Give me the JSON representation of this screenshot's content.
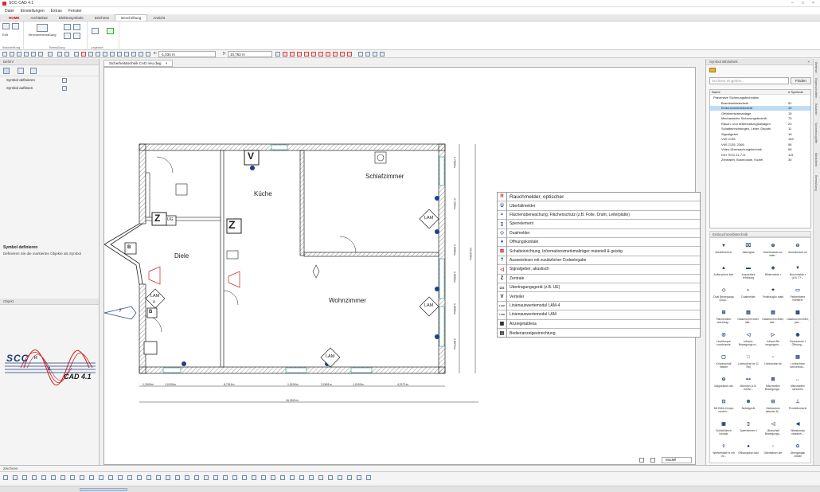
{
  "window": {
    "title": "SCC-CAD 4.1"
  },
  "menu": [
    "Datei",
    "Einstellungen",
    "Extras",
    "Fenster"
  ],
  "ribbon_tabs": [
    {
      "label": "HOME",
      "brand": true
    },
    {
      "label": "Architektur"
    },
    {
      "label": "Elektrosymbole"
    },
    {
      "label": "Zeichnen"
    },
    {
      "label": "Beschriftung",
      "active": true
    },
    {
      "label": "Ansicht"
    }
  ],
  "ribbon": {
    "groups": [
      "Beschriftung",
      "Bemaßung",
      "Legende"
    ],
    "edit_label": "Edit",
    "dimension_label": "Streckenbemaßung"
  },
  "toolbar": {
    "x_label": "x:",
    "x_value": "-1,034 m",
    "y_label": "y:",
    "y_value": "10,762 m"
  },
  "document_tab": "Sicherheitstechnik CAD neu.dwg",
  "left_panel": {
    "title": "Befehl",
    "items": [
      "Symbol definieren",
      "Symbol auflösen"
    ],
    "info_title": "Symbol definieren",
    "info_text": "Definieren Sie die markierten Objekte als Symbol",
    "object_title": "Objekt",
    "logo_text": "SCC",
    "logo_letters": [
      "H",
      "S"
    ],
    "logo_sub": "CAD 4.1"
  },
  "plan": {
    "rooms": [
      "Schlafzimmer",
      "Küche",
      "Diele",
      "Wohnzimmer"
    ],
    "dims_bottom": [
      "1,2000m",
      "1,0100m",
      "8,7011m",
      "1,0100m",
      "2,2601m",
      "1,0100m",
      "4,2171m"
    ],
    "dim_total": "16,3021m",
    "dims_right": [
      "1,7500m",
      "2,7453m",
      "1,5000m",
      "1,5000m",
      "1,0000m",
      "2,8875m"
    ],
    "dim_right_total": "13,1232m",
    "labels": [
      "V",
      "Z",
      "ÜG",
      "B",
      "LAM",
      "LAM",
      "LAM",
      "LAM",
      "4",
      "?"
    ]
  },
  "legend": [
    {
      "sym": "R",
      "text": "Rauchmelder, optischer",
      "big": true
    },
    {
      "sym": "Ü",
      "text": "Überfallmelder"
    },
    {
      "sym": "≈",
      "text": "Flächenüberwachung, Flächenschutz (z.B. Folie, Draht, Leiterplatte)"
    },
    {
      "sym": "▯",
      "text": "Sperrelement"
    },
    {
      "sym": "◇",
      "text": "Dualmelder"
    },
    {
      "sym": "●",
      "text": "Öffnungskontakt"
    },
    {
      "sym": "⊠",
      "text": "Schalteinrichtung, Informationsmerkmalträger materiell & geistig"
    },
    {
      "sym": "?",
      "text": "Ausweisleser mit zusätzlicher Codeeingabe"
    },
    {
      "sym": "◁",
      "text": "Signalgeber, akustisch"
    },
    {
      "sym": "Z",
      "text": "Zentrale"
    },
    {
      "sym": "ÜG",
      "text": "Übertragungsgerät (z.B. ÜE)"
    },
    {
      "sym": "V",
      "text": "Verteiler"
    },
    {
      "sym": "LAM",
      "text": "Linienauswertemodul LAM-4"
    },
    {
      "sym": "LAM",
      "text": "Linienauswertemodul LAM"
    },
    {
      "sym": "▦",
      "text": "Anzeigetableau"
    },
    {
      "sym": "▤",
      "text": "Bedienanzeigeeinrichtung"
    }
  ],
  "canvas_footer": {
    "model": "Modell"
  },
  "right_panel": {
    "title": "Symbol Bibliothek",
    "search_placeholder": "Suchtext eingeben...",
    "search_button": "Finden",
    "col_name": "Name",
    "col_count": "# Symbole",
    "tree": [
      {
        "name": "Präventive Sicherungstechniken",
        "count": "",
        "indent": 0
      },
      {
        "name": "Brandmeldetechnik",
        "count": "52",
        "indent": 1
      },
      {
        "name": "Einbruchmeldetechnik",
        "count": "40",
        "indent": 1,
        "selected": true
      },
      {
        "name": "Gefahrenwarnanlage",
        "count": "15",
        "indent": 1
      },
      {
        "name": "Mechanische Sicherungstechnik",
        "count": "75",
        "indent": 1
      },
      {
        "name": "Rauch- und Wärmeabzugsanlagen",
        "count": "20",
        "indent": 1
      },
      {
        "name": "Schalteinrichtungen, Leser, Depots",
        "count": "11",
        "indent": 1
      },
      {
        "name": "Signalgeber",
        "count": "16",
        "indent": 1
      },
      {
        "name": "VdS 2135",
        "count": "159",
        "indent": 1
      },
      {
        "name": "VdS 2135, 2366",
        "count": "56",
        "indent": 1
      },
      {
        "name": "Video-Überwachungstechnik",
        "count": "58",
        "indent": 1
      },
      {
        "name": "ISO 7010 21-7-H",
        "count": "119",
        "indent": 1
      },
      {
        "name": "Zentralen, Busmodule, Koziel",
        "count": "30",
        "indent": 1
      }
    ],
    "gallery_title": "Einbruchmeldetechnik",
    "gallery": [
      [
        "Abreißmeld er",
        "Alarmglas",
        "Anschlussdo se, unter...",
        "Anschlussdo se"
      ],
      [
        "Aufbruchme lder",
        "Ausweisles erhöhung",
        "Bildermelde r",
        "Bruchmelde r (z.B. T+..."
      ],
      [
        "Dual Bewegungs (Dual...",
        "Dualmelder",
        "Federzugko ntakt",
        "Feldmeldere rweiterer"
      ],
      [
        "Flächenüber wachung...",
        "Glasbruchm elder, akti...",
        "Glasbruchm elder, akti...",
        "Glasbruchm elder, pas..."
      ],
      [
        "Hochfreque nzschranke",
        "Infrarot-Bewegungs m...",
        "Infrarot-Be wegungsm...",
        "Koaxiomme r Öffnung..."
      ],
      [
        "Körperschall melder",
        "Lichtschran ke (1 Teil)",
        "Lichtschran ke",
        "Lichtschran kenverbun..."
      ],
      [
        "Magnetkont akt",
        "Mikrofon (z.B. Geräu...",
        "Mikrowellen Bewegungs...",
        "Mikrowellen schranke"
      ],
      [
        "Mit EMA-Kompo nenten...",
        "Nebelgerät",
        "Nichtautom atischer M...",
        "Pendelkonta kt"
      ],
      [
        "Schließblech kontakt",
        "Sperrelemen t",
        "Ultraschall Bewegungs...",
        "Vibrationsko ntaktmel..."
      ],
      [
        "Wertbehälte rs mit Vo...",
        "Öffnungskon takt",
        "Überfallmel der",
        "Übergangsk ontakt"
      ]
    ]
  },
  "vertical_tabs": [
    "Befehle",
    "Eigenschaften",
    "Bauteile",
    "Schnellzugriffe",
    "Bibliothek",
    "Bemaßung"
  ],
  "bottom_panel": {
    "title": "Zeichnen"
  }
}
